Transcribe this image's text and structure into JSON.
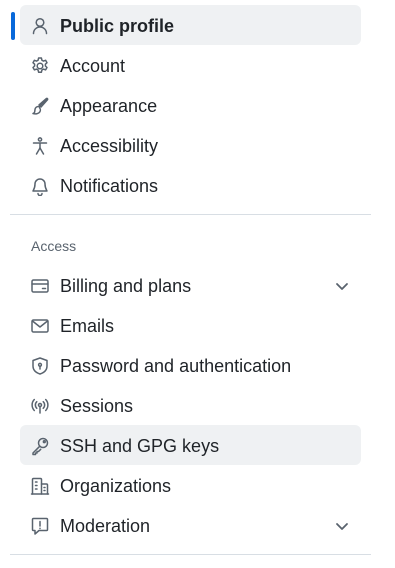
{
  "sidebar": {
    "items": [
      {
        "label": "Public profile",
        "icon": "person-icon",
        "selected": true
      },
      {
        "label": "Account",
        "icon": "gear-icon"
      },
      {
        "label": "Appearance",
        "icon": "paintbrush-icon"
      },
      {
        "label": "Accessibility",
        "icon": "accessibility-icon"
      },
      {
        "label": "Notifications",
        "icon": "bell-icon"
      }
    ],
    "access_section": {
      "heading": "Access",
      "items": [
        {
          "label": "Billing and plans",
          "icon": "credit-card-icon",
          "expandable": true
        },
        {
          "label": "Emails",
          "icon": "mail-icon"
        },
        {
          "label": "Password and authentication",
          "icon": "shield-lock-icon"
        },
        {
          "label": "Sessions",
          "icon": "broadcast-icon"
        },
        {
          "label": "SSH and GPG keys",
          "icon": "key-icon",
          "hovered": true
        },
        {
          "label": "Organizations",
          "icon": "organization-icon"
        },
        {
          "label": "Moderation",
          "icon": "report-icon",
          "expandable": true
        }
      ]
    }
  },
  "colors": {
    "accent": "#0969da",
    "selected_bg": "#eff1f3",
    "text": "#1f2328",
    "muted": "#59636e",
    "divider": "#d8dee4"
  }
}
